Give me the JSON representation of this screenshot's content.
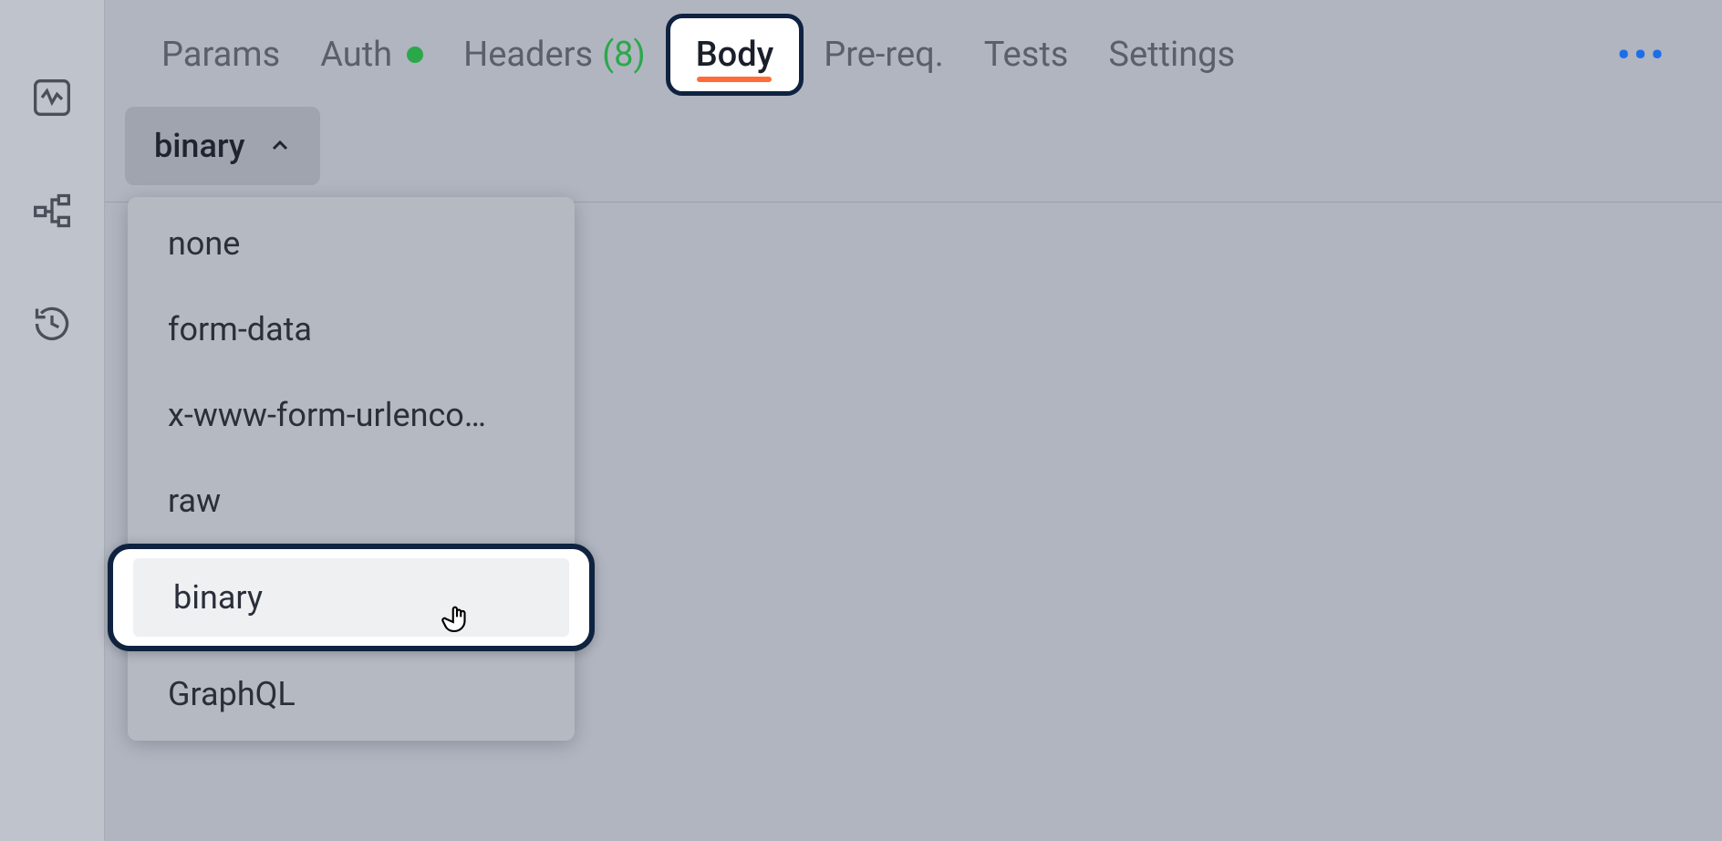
{
  "sidebar": {
    "icons": [
      "activity",
      "flow",
      "history"
    ]
  },
  "tabs": {
    "params": "Params",
    "auth": "Auth",
    "headers_label": "Headers",
    "headers_count": "(8)",
    "body": "Body",
    "prereq": "Pre-req.",
    "tests": "Tests",
    "settings": "Settings"
  },
  "body_type_selector": {
    "selected": "binary"
  },
  "dropdown": {
    "items": {
      "none": "none",
      "form_data": "form-data",
      "urlencoded": "x-www-form-urlenco…",
      "raw": "raw",
      "binary": "binary",
      "graphql": "GraphQL"
    }
  }
}
